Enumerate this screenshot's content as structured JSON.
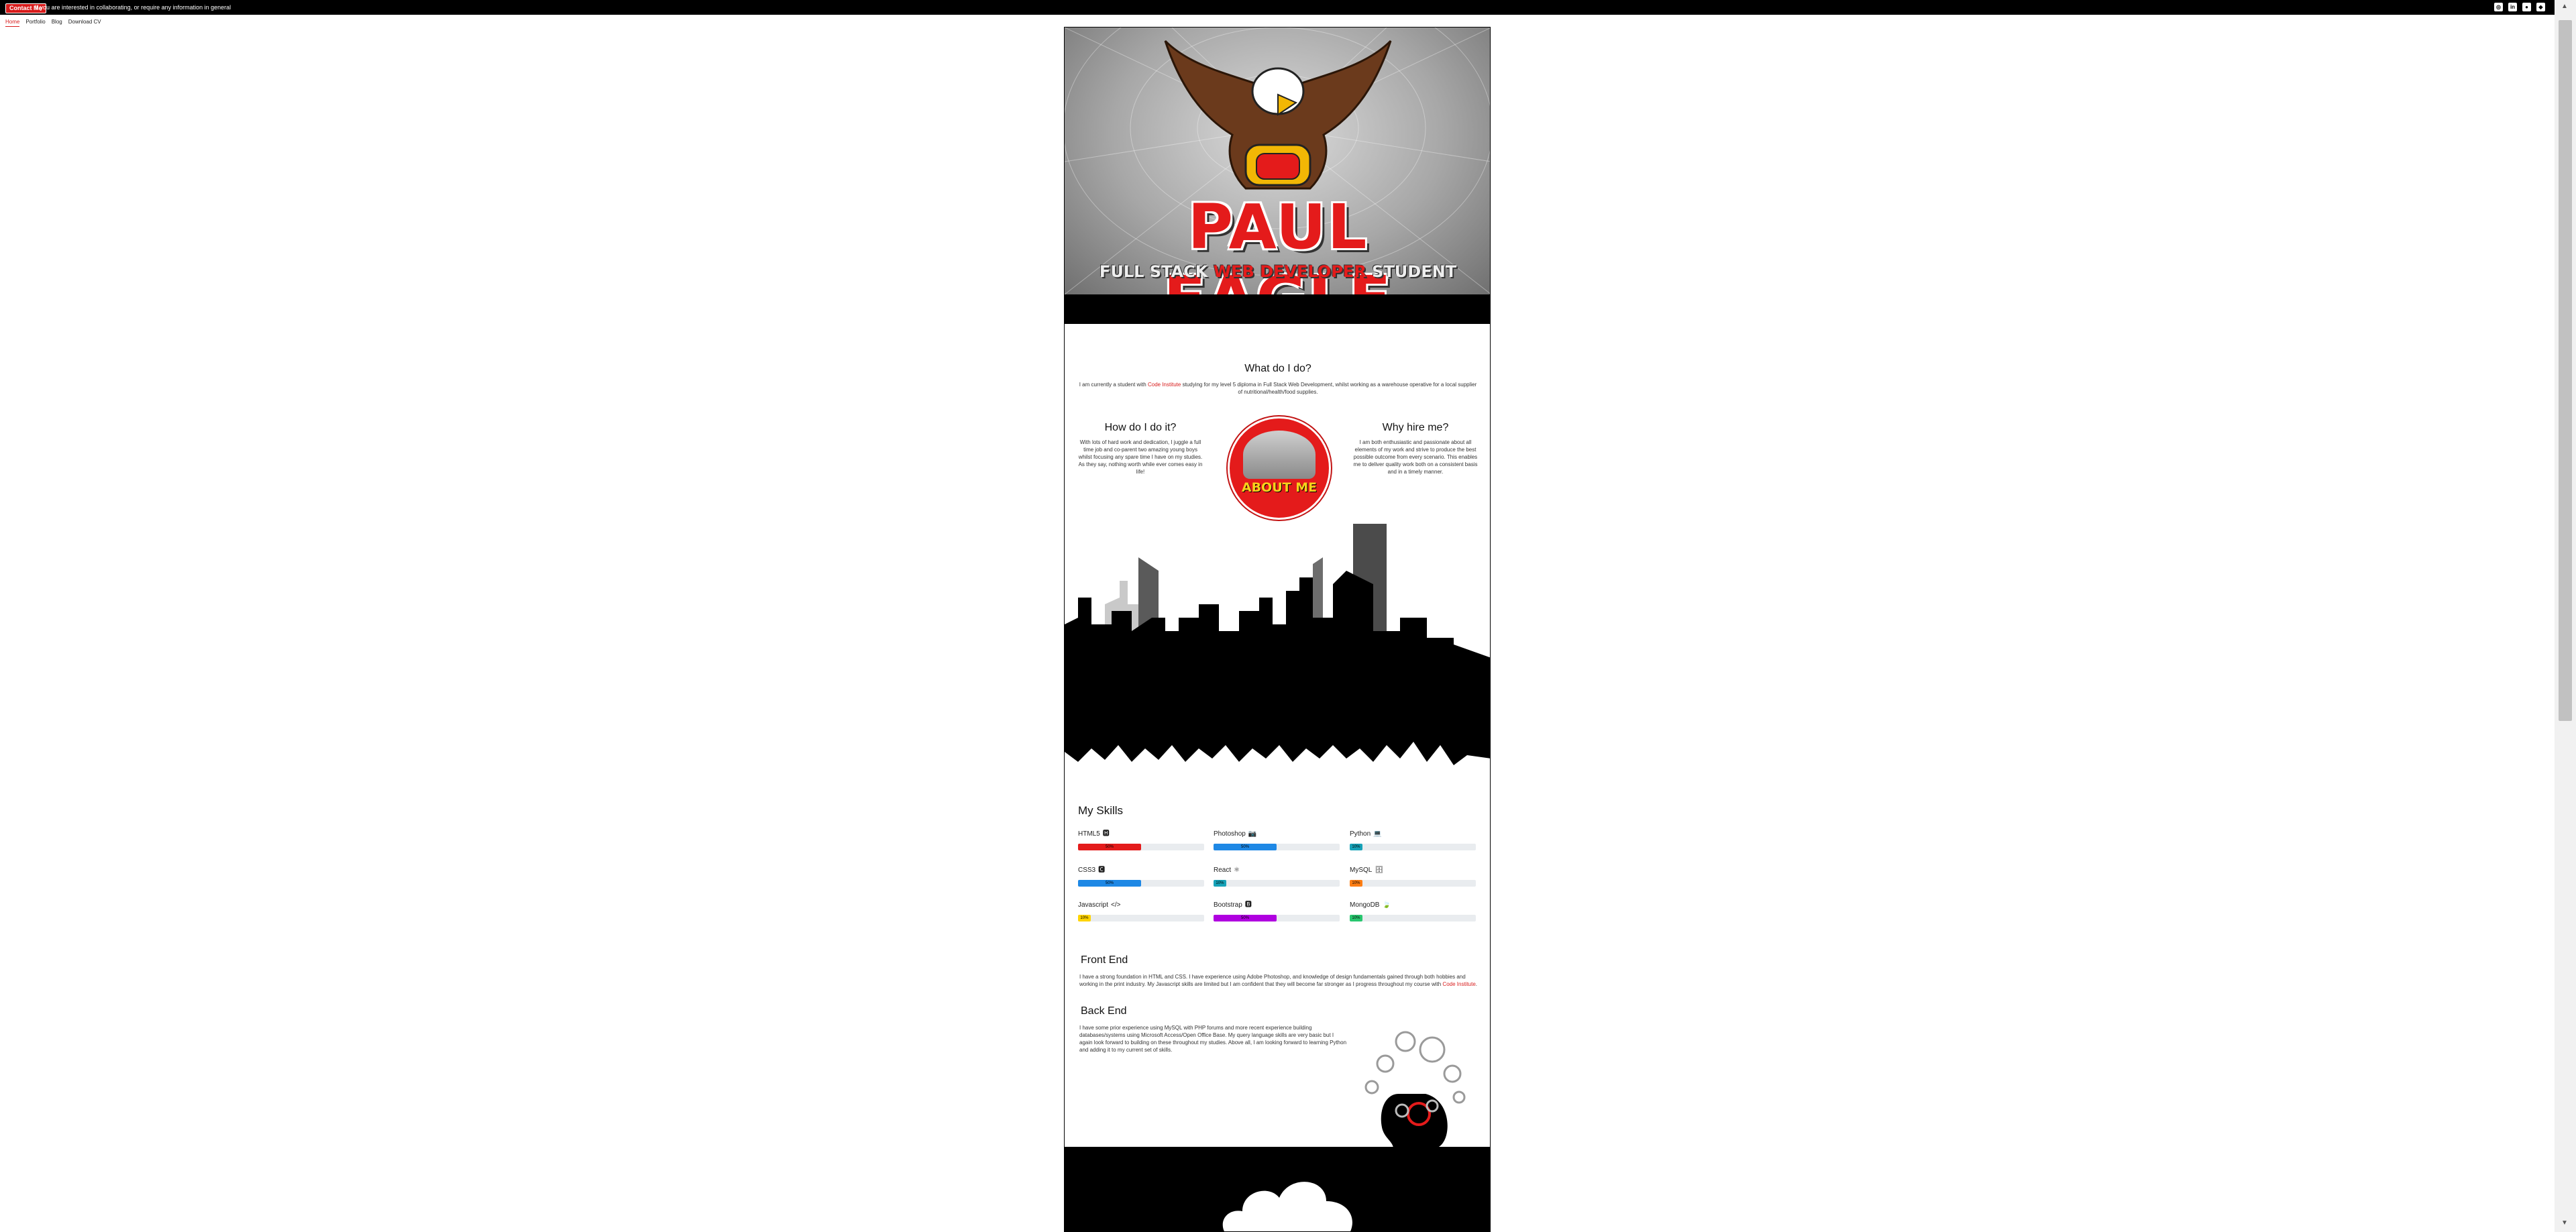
{
  "topbar": {
    "contact_label": "Contact Me",
    "message": "If you are interested in collaborating, or require any information in general"
  },
  "social": [
    {
      "icon": "instagram-icon",
      "glyph": "◎"
    },
    {
      "icon": "linkedin-icon",
      "glyph": "in"
    },
    {
      "icon": "github-icon",
      "glyph": "●"
    },
    {
      "icon": "codepen-icon",
      "glyph": "◆"
    }
  ],
  "nav": [
    {
      "label": "Home",
      "active": true
    },
    {
      "label": "Portfolio"
    },
    {
      "label": "Blog"
    },
    {
      "label": "Download CV"
    }
  ],
  "hero": {
    "title": "PAUL EAGLE",
    "sub_part1": "FULL STACK ",
    "sub_part2": "WEB DEVELOPER",
    "sub_part3": " STUDENT"
  },
  "what": {
    "title": "What do I do?",
    "text_before": "I am currently a student with ",
    "link": "Code Institute",
    "text_after": " studying for my level 5 diploma in Full Stack Web Development, whilst working as a warehouse operative for a local supplier of nutritional/health/food supplies."
  },
  "how": {
    "title": "How do I do it?",
    "text": "With lots of hard work and dedication, I juggle a full time job and co-parent two amazing young boys whilst focusing any spare time I have on my studies. As they say, nothing worth while ever comes easy in life!"
  },
  "about": {
    "label": "ABOUT ME"
  },
  "why": {
    "title": "Why hire me?",
    "text": "I am both enthusiastic and passionate about all elements of my work and strive to produce the best possible outcome from every scenario. This enables me to deliver quality work both on a consistent basis and in a timely manner."
  },
  "skills": {
    "title": "My Skills",
    "items": [
      {
        "name": "HTML5",
        "icon": "html5-icon",
        "glyph": "🅷",
        "percent": 50,
        "label": "50%",
        "color": "#e41b1b"
      },
      {
        "name": "Photoshop",
        "icon": "camera-icon",
        "glyph": "📷",
        "percent": 50,
        "label": "50%",
        "color": "#1e88e5"
      },
      {
        "name": "Python",
        "icon": "laptop-icon",
        "glyph": "💻",
        "percent": 10,
        "label": "10%",
        "color": "#17a2b8"
      },
      {
        "name": "CSS3",
        "icon": "css3-icon",
        "glyph": "🅲",
        "percent": 50,
        "label": "50%",
        "color": "#1e88e5"
      },
      {
        "name": "React",
        "icon": "react-icon",
        "glyph": "⚛",
        "percent": 10,
        "label": "10%",
        "color": "#17a2b8"
      },
      {
        "name": "MySQL",
        "icon": "database-icon",
        "glyph": "🗄",
        "percent": 10,
        "label": "10%",
        "color": "#fd7e14"
      },
      {
        "name": "Javascript",
        "icon": "code-icon",
        "glyph": "</>",
        "percent": 10,
        "label": "10%",
        "color": "#ffd400"
      },
      {
        "name": "Bootstrap",
        "icon": "bootstrap-icon",
        "glyph": "🅱",
        "percent": 50,
        "label": "50%",
        "color": "#b000e0"
      },
      {
        "name": "MongoDB",
        "icon": "leaf-icon",
        "glyph": "🍃",
        "percent": 10,
        "label": "10%",
        "color": "#28c76f"
      }
    ]
  },
  "frontend": {
    "title": "Front End",
    "text_before": "I have a strong foundation in HTML and CSS. I have experience using Adobe Photoshop, and knowledge of design fundamentals gained through both hobbies and working in the print industry. My Javascript skills are limited but I am confident that they will become far stronger as I progress throughout my course with ",
    "link": "Code Institute",
    "text_after": "."
  },
  "backend": {
    "title": "Back End",
    "text": "I have some prior experience using MySQL with PHP forums and more recent experience building databases/systems using Microsoft Access/Open Office Base. My query language skills are very basic but I again look forward to building on these throughout my studies. Above all, I am looking forward to learning Python and adding it to my current set of skills."
  }
}
